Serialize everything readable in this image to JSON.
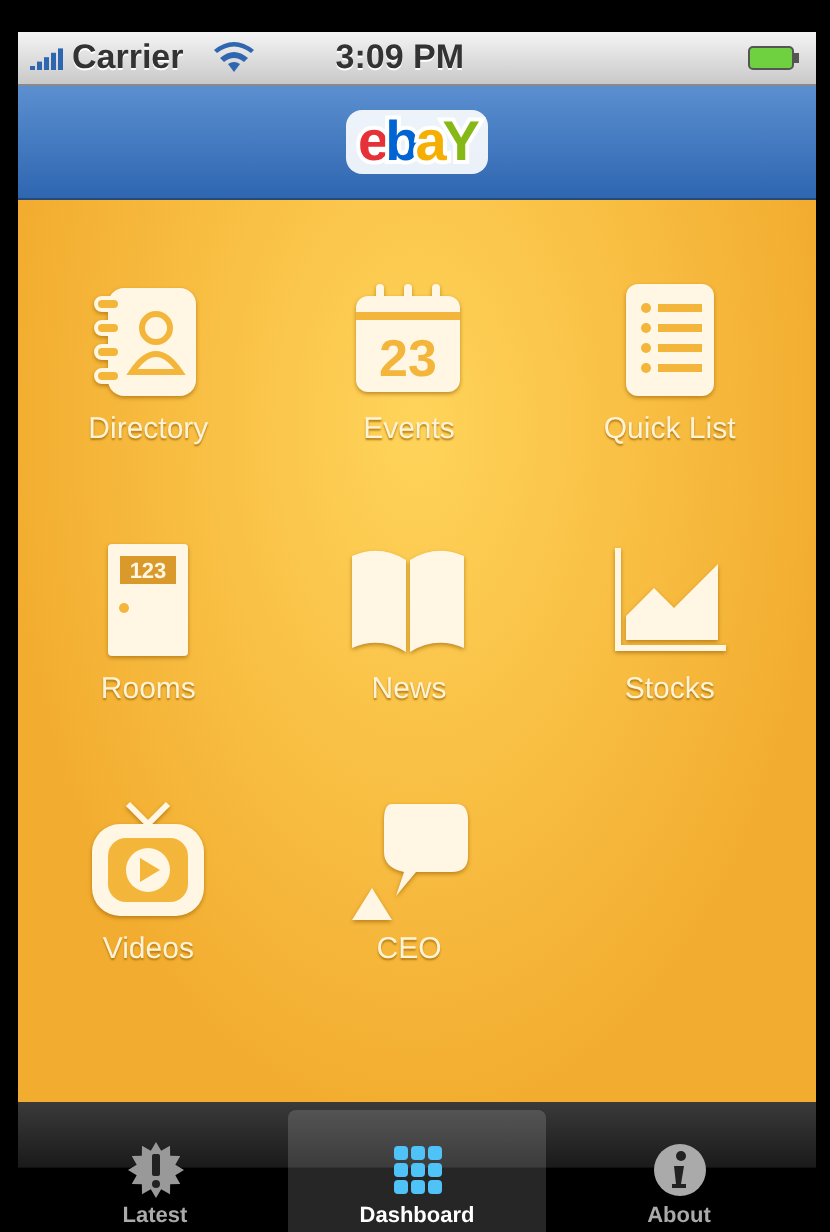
{
  "status_bar": {
    "carrier": "Carrier",
    "time": "3:09 PM"
  },
  "logo": {
    "letters": [
      {
        "char": "e",
        "color": "#e53238"
      },
      {
        "char": "b",
        "color": "#0064d2"
      },
      {
        "char": "a",
        "color": "#f5af02"
      },
      {
        "char": "Y",
        "color": "#86b817"
      }
    ]
  },
  "dashboard": {
    "items": [
      {
        "label": "Directory",
        "kind": "directory"
      },
      {
        "label": "Events",
        "kind": "calendar",
        "icon_text": "23"
      },
      {
        "label": "Quick List",
        "kind": "list"
      },
      {
        "label": "Rooms",
        "kind": "door",
        "icon_text": "123"
      },
      {
        "label": "News",
        "kind": "book"
      },
      {
        "label": "Stocks",
        "kind": "chart"
      },
      {
        "label": "Videos",
        "kind": "tv"
      },
      {
        "label": "CEO",
        "kind": "speech"
      }
    ]
  },
  "tab_bar": {
    "tabs": [
      {
        "label": "Latest",
        "kind": "alert",
        "selected": false
      },
      {
        "label": "Dashboard",
        "kind": "grid",
        "selected": true
      },
      {
        "label": "About",
        "kind": "info",
        "selected": false
      }
    ]
  }
}
